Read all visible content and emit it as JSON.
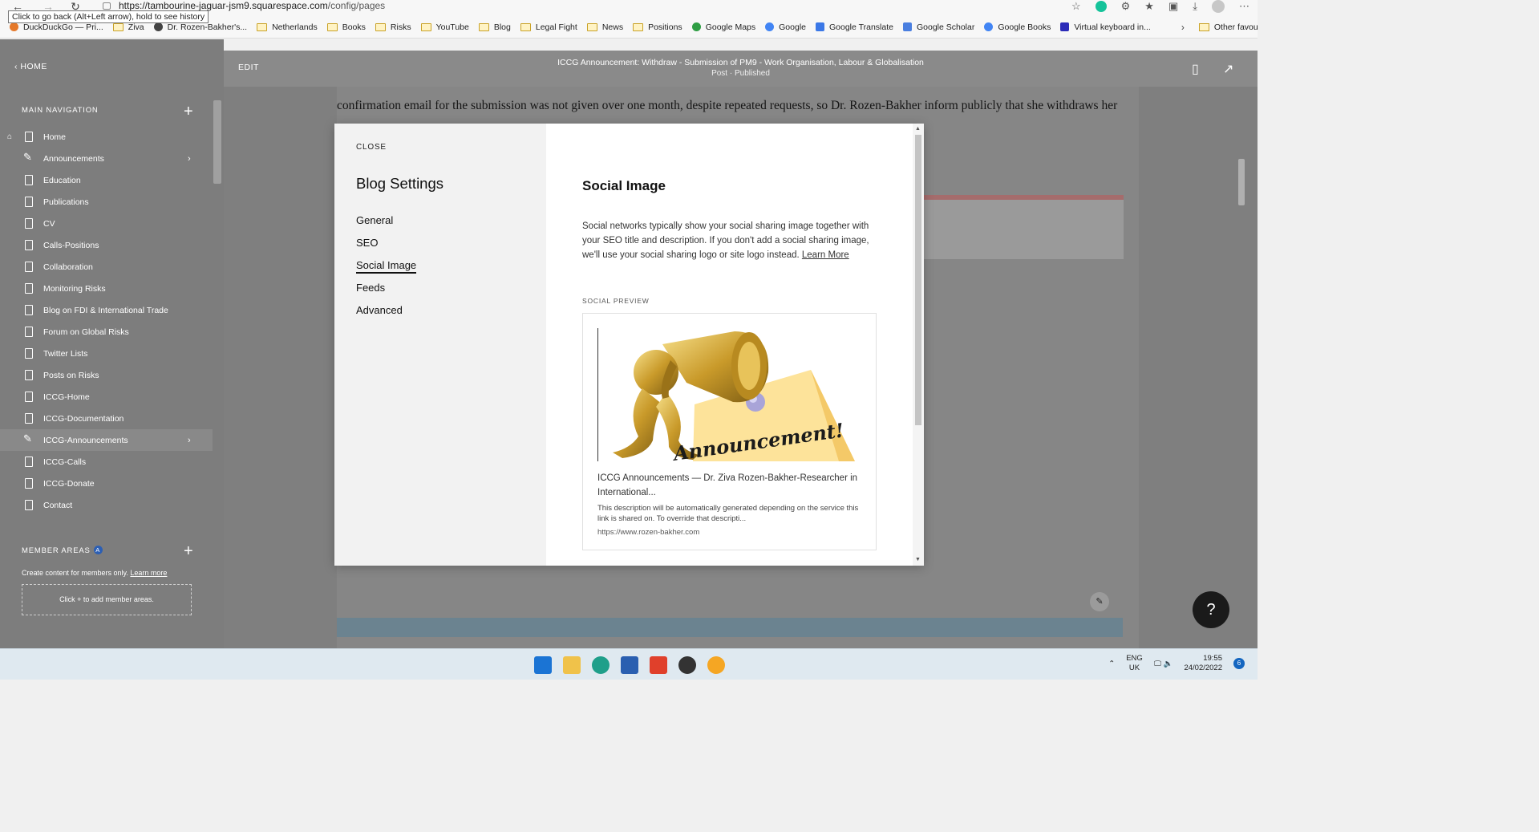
{
  "browser": {
    "url_host": "https://tambourine-jaguar-jsm9.squarespace.com",
    "url_path": "/config/pages",
    "tooltip": "Click to go back (Alt+Left arrow), hold to see history"
  },
  "bookmarks": {
    "items": [
      "DuckDuckGo — Pri...",
      "Ziva",
      "Dr. Rozen-Bakher's...",
      "Netherlands",
      "Books",
      "Risks",
      "YouTube",
      "Blog",
      "Legal Fight",
      "News",
      "Positions",
      "Google Maps",
      "Google",
      "Google Translate",
      "Google Scholar",
      "Google Books",
      "Virtual keyboard in..."
    ],
    "other": "Other favourites"
  },
  "sidebar": {
    "home": "HOME",
    "main_nav_title": "MAIN NAVIGATION",
    "items": [
      {
        "label": "Home"
      },
      {
        "label": "Announcements"
      },
      {
        "label": "Education"
      },
      {
        "label": "Publications"
      },
      {
        "label": "CV"
      },
      {
        "label": "Calls-Positions"
      },
      {
        "label": "Collaboration"
      },
      {
        "label": "Monitoring Risks"
      },
      {
        "label": "Blog on FDI & International Trade"
      },
      {
        "label": "Forum on Global Risks"
      },
      {
        "label": "Twitter Lists"
      },
      {
        "label": "Posts on Risks"
      },
      {
        "label": "ICCG-Home"
      },
      {
        "label": "ICCG-Documentation"
      },
      {
        "label": "ICCG-Announcements"
      },
      {
        "label": "ICCG-Calls"
      },
      {
        "label": "ICCG-Donate"
      },
      {
        "label": "Contact"
      }
    ],
    "member_title": "MEMBER AREAS",
    "member_badge": "A",
    "member_text": "Create content for members only.",
    "member_learn": "Learn more",
    "member_add": "Click + to add member areas."
  },
  "editor": {
    "edit_label": "EDIT",
    "page_title": "ICCG Announcement: Withdraw - Submission of PM9 - Work Organisation, Labour & Globalisation",
    "page_subtitle": "Post · Published",
    "body_text": "confirmation email for the submission was not given over one month, despite repeated requests, so Dr. Rozen-Bakher inform publicly that she withdraws her",
    "help": "?"
  },
  "modal": {
    "close": "CLOSE",
    "title": "Blog Settings",
    "nav": [
      "General",
      "SEO",
      "Social Image",
      "Feeds",
      "Advanced"
    ],
    "section_title": "Social Image",
    "description": "Social networks typically show your social sharing image together with your SEO title and description. If you don't add a social sharing image, we'll use your social sharing logo or site logo instead.",
    "learn_more": "Learn More",
    "preview_label": "SOCIAL PREVIEW",
    "card_title": "ICCG Announcements — Dr. Ziva Rozen-Bakher-Researcher in International...",
    "card_desc": "This description will be automatically generated depending on the service this link is shared on. To override that descripti...",
    "card_url": "https://www.rozen-bakher.com",
    "image_text": "Announcement!"
  },
  "taskbar": {
    "lang1": "ENG",
    "lang2": "UK",
    "time": "19:55",
    "date": "24/02/2022",
    "notifications": "6"
  }
}
